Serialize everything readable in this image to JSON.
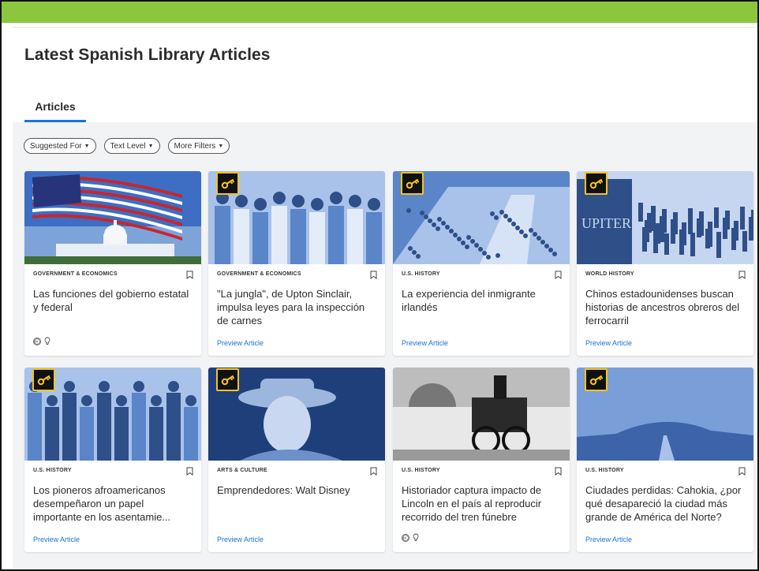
{
  "page": {
    "title": "Latest Spanish Library Articles",
    "accent_color": "#8cc63f",
    "link_color": "#1a73d9"
  },
  "tabs": [
    {
      "label": "Articles",
      "active": true
    }
  ],
  "filters": [
    {
      "label": "Suggested For"
    },
    {
      "label": "Text Level"
    },
    {
      "label": "More Filters"
    }
  ],
  "articles": [
    {
      "category": "GOVERNMENT & ECONOMICS",
      "title": "Las funciones del gobierno estatal y federal",
      "locked": false,
      "footer": "badges",
      "image": "capitol-flag"
    },
    {
      "category": "GOVERNMENT & ECONOMICS",
      "title": "\"La jungla\", de Upton Sinclair, impulsa leyes para la inspección de carnes",
      "locked": true,
      "footer": "preview",
      "preview_label": "Preview Article",
      "image": "workers"
    },
    {
      "category": "U.S. HISTORY",
      "title": "La experiencia del inmigrante irlandés",
      "locked": true,
      "footer": "preview",
      "preview_label": "Preview Article",
      "image": "harbor-crowd"
    },
    {
      "category": "WORLD HISTORY",
      "title": "Chinos estadounidenses buscan historias de ancestros obreros del ferrocarril",
      "locked": true,
      "footer": "preview",
      "preview_label": "Preview Article",
      "image": "railroad-crowd"
    },
    {
      "category": "U.S. HISTORY",
      "title": "Los pioneros afroamericanos desempeñaron un papel importante en los asentamie...",
      "locked": true,
      "footer": "preview",
      "preview_label": "Preview Article",
      "image": "soldiers"
    },
    {
      "category": "ARTS & CULTURE",
      "title": "Emprendedores: Walt Disney",
      "locked": true,
      "footer": "preview",
      "preview_label": "Preview Article",
      "image": "portrait"
    },
    {
      "category": "U.S. HISTORY",
      "title": "Historiador captura impacto de Lincoln en el país al reproducir recorrido del tren fúnebre",
      "locked": false,
      "footer": "badges",
      "image": "locomotive"
    },
    {
      "category": "U.S. HISTORY",
      "title": "Ciudades perdidas: Cahokia, ¿por qué desapareció la ciudad más grande de América del Norte?",
      "locked": true,
      "footer": "preview",
      "preview_label": "Preview Article",
      "image": "mound"
    }
  ]
}
